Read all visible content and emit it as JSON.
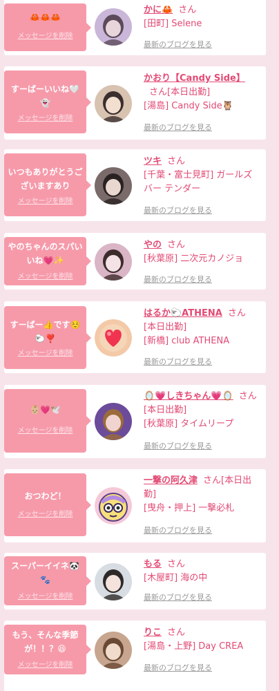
{
  "palette": {
    "background": "#f7e4ea",
    "card": "#ffffff",
    "bubble": "#f69aaa",
    "accent_text": "#e24a74",
    "link_gray": "#9a9a9a"
  },
  "delete_label": "メッセージを削除",
  "blog_label": "最新のブログを見る",
  "san_label": "さん",
  "entries": [
    {
      "message": "🦀🦀🦀",
      "name": "かに🦀",
      "status": "",
      "shop": "[田町] Selene",
      "avatar_icon": "avatar-photo"
    },
    {
      "message": "すーばーいいね🤍👻",
      "name": "かおり【Candy Side】",
      "status": "[本日出勤]",
      "shop": "[湯島] Candy Side🦉",
      "avatar_icon": "avatar-photo"
    },
    {
      "message": "いつもありがとうございますあり",
      "name": "ツキ",
      "status": "",
      "shop": "[千葉・富士見町] ガールズバー テンダー",
      "avatar_icon": "avatar-photo"
    },
    {
      "message": "やのちゃんのスパいいね💗✨",
      "name": "やの",
      "status": "",
      "shop": "[秋葉原] 二次元カノジョ",
      "avatar_icon": "avatar-photo"
    },
    {
      "message": "すーばー👍です☺️🐑❣️",
      "name": "はるか🐑ATHENA",
      "status": "[本日出勤]",
      "shop": "[新橋] club ATHENA",
      "avatar_icon": "heart-emoji-avatar"
    },
    {
      "message": "👶🏼💗🕊️",
      "name": "🪞💗しきちゃん💗🪞",
      "status": "[本日出勤]",
      "shop": "[秋葉原] タイムリープ",
      "avatar_icon": "avatar-photo"
    },
    {
      "message": "おつわど！",
      "name": "一撃の阿久津",
      "status": "[本日出勤]",
      "shop": "[曳舟・押上] 一撃必札",
      "avatar_icon": "cartoon-mascot-avatar"
    },
    {
      "message": "スーパーイイネ🐼🐾",
      "name": "もる",
      "status": "",
      "shop": "[木屋町] 海の中",
      "avatar_icon": "avatar-photo"
    },
    {
      "message": "もう、そんな季節が！！？😆",
      "name": "りこ",
      "status": "",
      "shop": "[湯島・上野] Day CREA",
      "avatar_icon": "avatar-photo"
    }
  ]
}
